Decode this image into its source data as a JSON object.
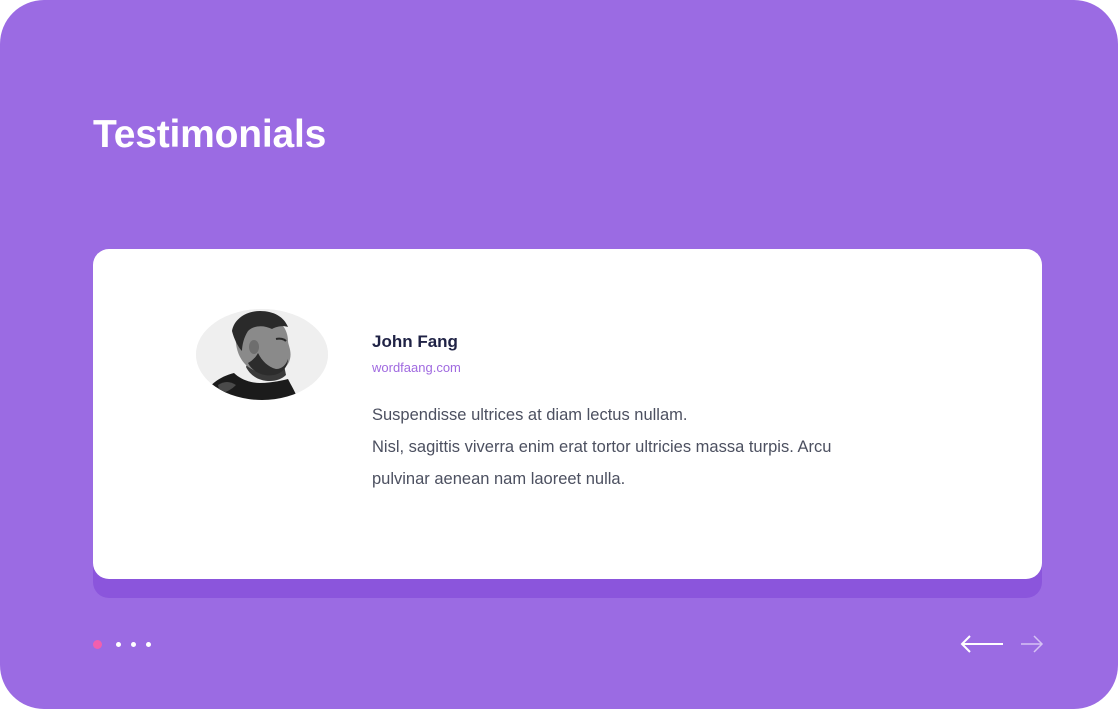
{
  "section": {
    "title": "Testimonials"
  },
  "testimonial": {
    "name": "John Fang",
    "website": "wordfaang.com",
    "quote_lines": [
      "Suspendisse ultrices at diam lectus nullam.",
      "Nisl, sagittis viverra enim erat tortor ultricies massa turpis. Arcu",
      "pulvinar aenean nam laoreet nulla."
    ]
  },
  "pagination": {
    "total": 4,
    "active_index": 0,
    "active_color": "#f15fae",
    "inactive_color": "#ffffff"
  },
  "navigation": {
    "prev_icon": "arrow-left-icon",
    "next_icon": "arrow-right-icon"
  },
  "colors": {
    "background": "#9b6be3",
    "card": "#ffffff",
    "card_shadow": "#8b55dc",
    "name": "#1f2245",
    "website": "#a06ae0",
    "body_text": "#4c5060"
  }
}
